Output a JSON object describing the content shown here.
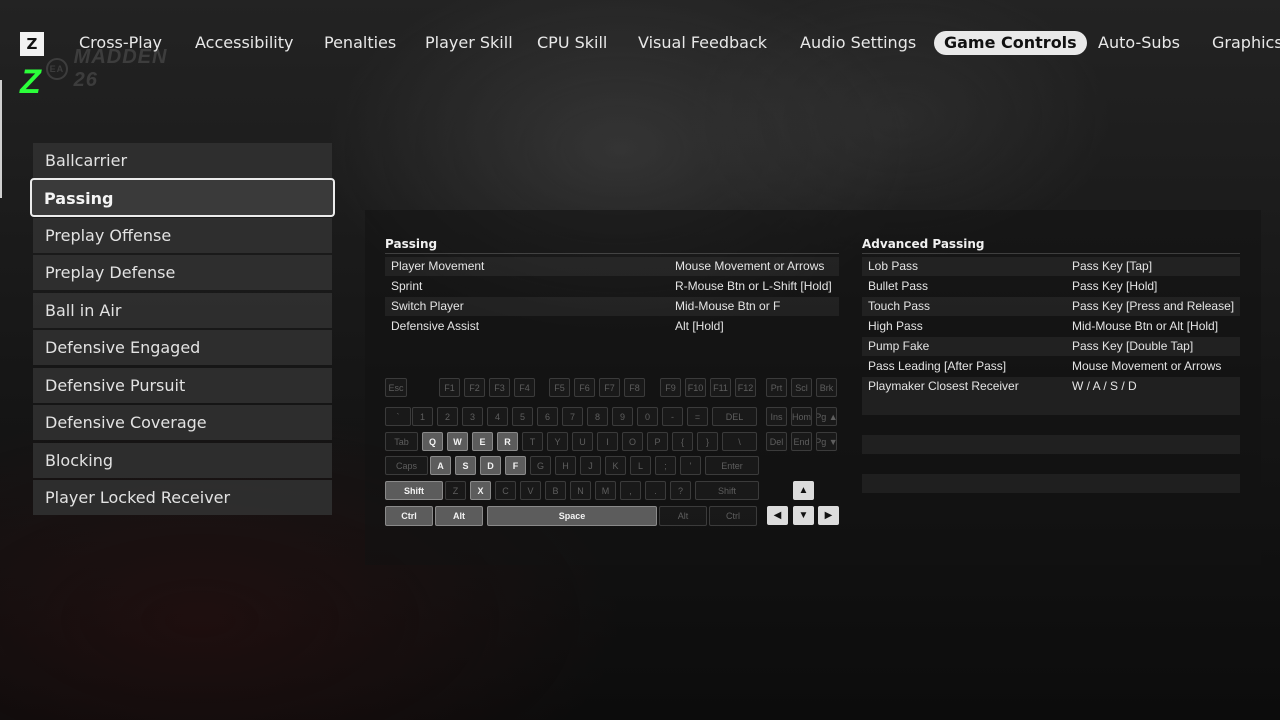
{
  "header": {
    "lb_key": "Z",
    "brand_glyph": "Z",
    "logo_text": "MADDEN 26",
    "logo_ea": "EA",
    "tabs": [
      {
        "label": "Cross-Play"
      },
      {
        "label": "Accessibility"
      },
      {
        "label": "Penalties"
      },
      {
        "label": "Player Skill"
      },
      {
        "label": "CPU Skill"
      },
      {
        "label": "Visual Feedback"
      },
      {
        "label": "Audio Settings"
      },
      {
        "label": "Game Controls",
        "active": true
      },
      {
        "label": "Auto-Subs"
      },
      {
        "label": "Graphics"
      }
    ]
  },
  "sidebar": {
    "selected": "Passing",
    "items": [
      {
        "label": "Ballcarrier"
      },
      {
        "label": "Passing"
      },
      {
        "label": "Preplay Offense"
      },
      {
        "label": "Preplay Defense"
      },
      {
        "label": "Ball in Air"
      },
      {
        "label": "Defensive Engaged"
      },
      {
        "label": "Defensive Pursuit"
      },
      {
        "label": "Defensive Coverage"
      },
      {
        "label": "Blocking"
      },
      {
        "label": "Player Locked Receiver"
      }
    ]
  },
  "passing": {
    "title": "Passing",
    "rows": [
      {
        "action": "Player Movement",
        "key": "Mouse Movement or Arrows"
      },
      {
        "action": "Sprint",
        "key": "R-Mouse Btn or L-Shift [Hold]"
      },
      {
        "action": "Switch Player",
        "key": "Mid-Mouse Btn or F"
      },
      {
        "action": "Defensive Assist",
        "key": "Alt [Hold]"
      }
    ]
  },
  "advanced_passing": {
    "title": "Advanced Passing",
    "rows": [
      {
        "action": "Lob Pass",
        "key": "Pass Key [Tap]"
      },
      {
        "action": "Bullet Pass",
        "key": "Pass Key [Hold]"
      },
      {
        "action": "Touch Pass",
        "key": "Pass Key [Press and Release]"
      },
      {
        "action": "High Pass",
        "key": "Mid-Mouse Btn or Alt [Hold]"
      },
      {
        "action": "Pump Fake",
        "key": "Pass Key [Double Tap]"
      },
      {
        "action": "Pass Leading [After Pass]",
        "key": "Mouse Movement or Arrows"
      },
      {
        "action": "Playmaker Closest Receiver",
        "key": "W / A / S / D"
      }
    ]
  },
  "keyboard": {
    "highlighted": [
      "Q",
      "W",
      "E",
      "R",
      "A",
      "S",
      "D",
      "F",
      "X",
      "Shift",
      "Alt",
      "Space",
      "Ctrl"
    ],
    "rows": [
      [
        "Esc",
        "F1",
        "F2",
        "F3",
        "F4",
        "F5",
        "F6",
        "F7",
        "F8",
        "F9",
        "F10",
        "F11",
        "F12",
        "Prt",
        "Scl",
        "Brk"
      ],
      [
        "`",
        "1",
        "2",
        "3",
        "4",
        "5",
        "6",
        "7",
        "8",
        "9",
        "0",
        "-",
        "=",
        "DEL",
        "Ins",
        "Hom",
        "Pg ▲"
      ],
      [
        "Tab",
        "Q",
        "W",
        "E",
        "R",
        "T",
        "Y",
        "U",
        "I",
        "O",
        "P",
        "{",
        "}",
        "\\",
        "Del",
        "End",
        "Pg ▼"
      ],
      [
        "Caps",
        "A",
        "S",
        "D",
        "F",
        "G",
        "H",
        "J",
        "K",
        "L",
        ";",
        "'",
        "Enter"
      ],
      [
        "Shift",
        "Z",
        "X",
        "C",
        "V",
        "B",
        "N",
        "M",
        ",",
        ".",
        "?",
        "Shift"
      ],
      [
        "Ctrl",
        "Alt",
        "Space",
        "Alt",
        "Ctrl"
      ]
    ],
    "arrows": {
      "up": "▲",
      "left": "◀",
      "down": "▼",
      "right": "▶"
    }
  }
}
